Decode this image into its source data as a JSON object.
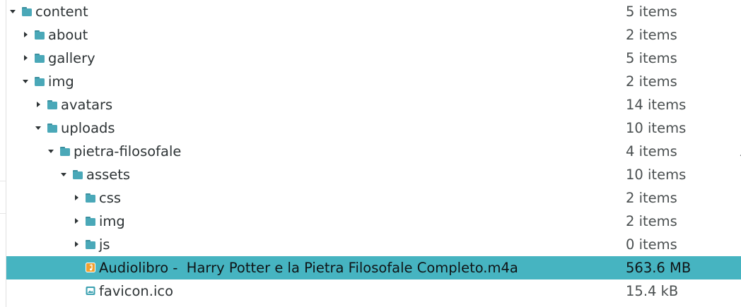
{
  "tree": {
    "rows": [
      {
        "name": "content",
        "size": "5 items",
        "kind": "folder",
        "expander": "expanded"
      },
      {
        "name": "about",
        "size": "2 items",
        "kind": "folder",
        "expander": "collapsed"
      },
      {
        "name": "gallery",
        "size": "5 items",
        "kind": "folder",
        "expander": "collapsed"
      },
      {
        "name": "img",
        "size": "2 items",
        "kind": "folder",
        "expander": "expanded"
      },
      {
        "name": "avatars",
        "size": "14 items",
        "kind": "folder",
        "expander": "collapsed"
      },
      {
        "name": "uploads",
        "size": "10 items",
        "kind": "folder",
        "expander": "expanded"
      },
      {
        "name": "pietra-filosofale",
        "size": "4 items",
        "kind": "folder",
        "expander": "expanded"
      },
      {
        "name": "assets",
        "size": "10 items",
        "kind": "folder",
        "expander": "expanded"
      },
      {
        "name": "css",
        "size": "2 items",
        "kind": "folder",
        "expander": "collapsed"
      },
      {
        "name": "img",
        "size": "2 items",
        "kind": "folder",
        "expander": "collapsed"
      },
      {
        "name": "js",
        "size": "0 items",
        "kind": "folder",
        "expander": "collapsed"
      },
      {
        "name": "Audiolibro -  Harry Potter e la Pietra Filosofale Completo.m4a",
        "size": "563.6 MB",
        "kind": "audio-file",
        "expander": "none",
        "selected": true
      },
      {
        "name": "favicon.ico",
        "size": "15.4 kB",
        "kind": "image-file",
        "expander": "none"
      }
    ]
  },
  "colors": {
    "selection": "#46b4c1",
    "folder": "#4aa8b8",
    "folder_tab": "#3a8f9e",
    "audio_icon": "#f0a030",
    "image_icon": "#3aa0b0",
    "expander": "#2e3436"
  },
  "icons": {
    "folder": "folder-icon",
    "audio-file": "audio-file-icon",
    "image-file": "image-file-icon",
    "expanded": "triangle-down-icon",
    "collapsed": "triangle-right-icon"
  }
}
